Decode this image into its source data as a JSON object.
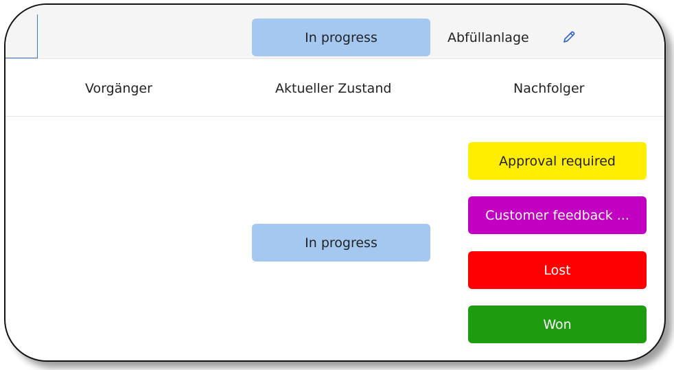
{
  "topbar": {
    "status_label": "In progress",
    "record_name": "Abfüllanlage",
    "edit_icon": "pencil-icon"
  },
  "columns": {
    "predecessor": "Vorgänger",
    "current": "Aktueller Zustand",
    "successor": "Nachfolger"
  },
  "current_state": {
    "label": "In progress",
    "color": "#a4c8f0"
  },
  "successors": [
    {
      "label": "Approval required",
      "color": "#ffee00",
      "text_color": "#222222"
    },
    {
      "label": "Customer feedback ...",
      "color": "#c200c2",
      "text_color": "#ffffff"
    },
    {
      "label": "Lost",
      "color": "#ff0000",
      "text_color": "#ffffff"
    },
    {
      "label": "Won",
      "color": "#1e9b0f",
      "text_color": "#ffffff"
    }
  ]
}
